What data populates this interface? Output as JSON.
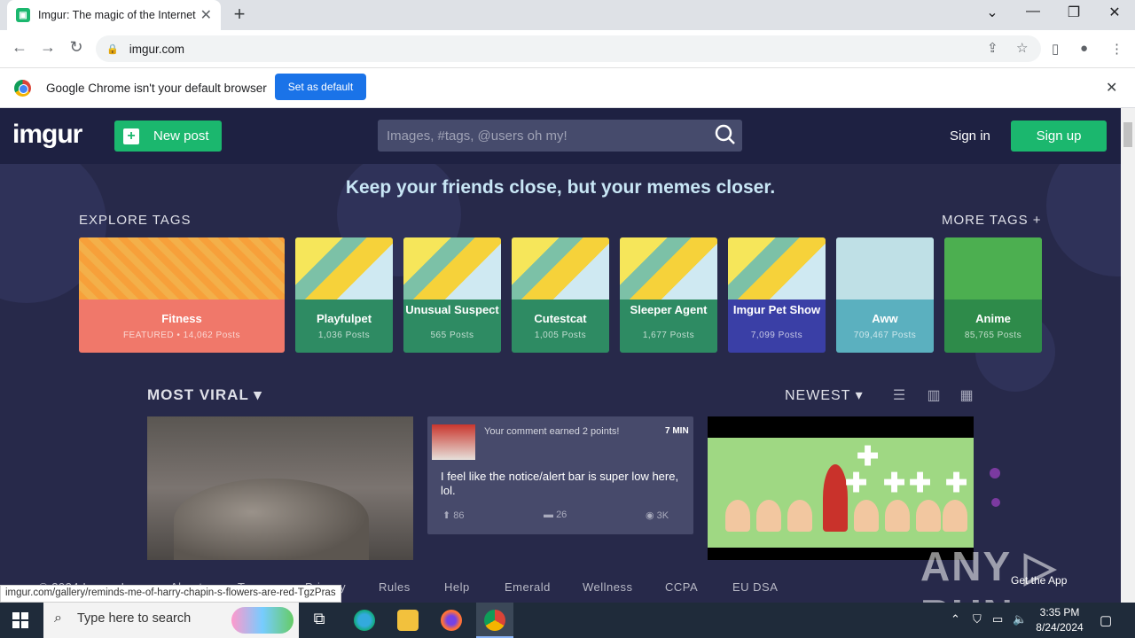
{
  "browser": {
    "tab_title": "Imgur: The magic of the Internet",
    "url": "imgur.com",
    "infobar_text": "Google Chrome isn't your default browser",
    "set_default_label": "Set as default",
    "status_url": "imgur.com/gallery/reminds-me-of-harry-chapin-s-flowers-are-red-TgzPras"
  },
  "header": {
    "logo": "imgur",
    "new_post": "New post",
    "search_placeholder": "Images, #tags, @users oh my!",
    "sign_in": "Sign in",
    "sign_up": "Sign up"
  },
  "tagline": "Keep your friends close, but your memes closer.",
  "explore": {
    "heading": "EXPLORE TAGS",
    "more": "MORE TAGS +",
    "tags": [
      {
        "name": "Fitness",
        "count": "FEATURED • 14,062 Posts",
        "color": "#f0786a"
      },
      {
        "name": "Playfulpet",
        "count": "1,036 Posts",
        "color": "#2e8b63"
      },
      {
        "name": "Unusual Suspect",
        "count": "565 Posts",
        "color": "#2e8b63"
      },
      {
        "name": "Cutestcat",
        "count": "1,005 Posts",
        "color": "#2e8b63"
      },
      {
        "name": "Sleeper Agent",
        "count": "1,677 Posts",
        "color": "#2e8b63"
      },
      {
        "name": "Imgur Pet Show",
        "count": "7,099 Posts",
        "color": "#3a3fa6"
      },
      {
        "name": "Aww",
        "count": "709,467 Posts",
        "color": "#5bb0bf"
      },
      {
        "name": "Anime",
        "count": "85,765 Posts",
        "color": "#2e8b4a"
      }
    ]
  },
  "feed": {
    "sort_label": "MOST VIRAL",
    "order_label": "NEWEST",
    "post2": {
      "notice": "Your comment earned 2 points!",
      "time": "7 MIN",
      "title": "I feel like the notice/alert bar is super low here, lol.",
      "upvotes": "86",
      "comments": "26",
      "views": "3K"
    }
  },
  "footer": {
    "copyright": "© 2024 Imgur, Inc",
    "links": [
      "About",
      "Terms",
      "Privacy",
      "Rules",
      "Help",
      "Emerald",
      "Wellness",
      "CCPA",
      "EU DSA"
    ],
    "get_app": "Get the App",
    "watermark": "ANY RUN"
  },
  "taskbar": {
    "search_placeholder": "Type here to search",
    "time": "3:35 PM",
    "date": "8/24/2024"
  }
}
